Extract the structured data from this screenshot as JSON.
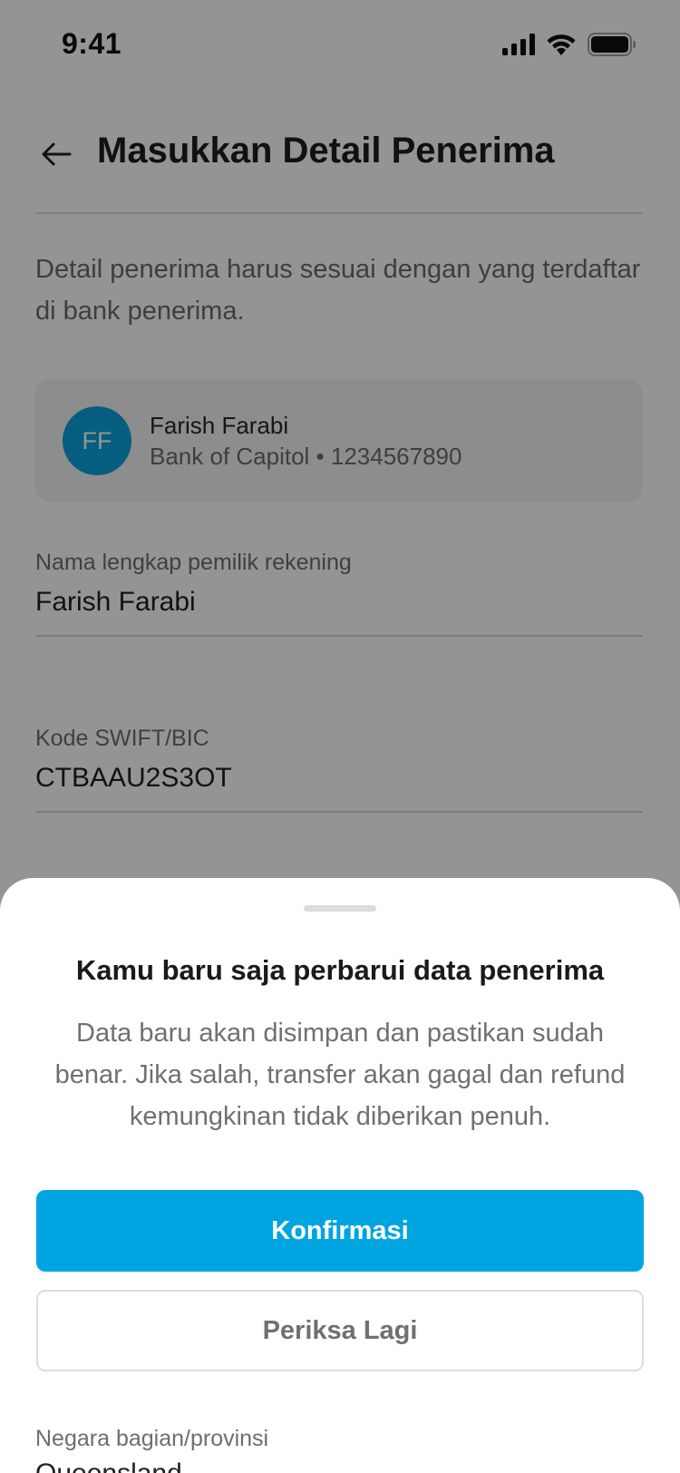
{
  "status_bar": {
    "time": "9:41",
    "icons": [
      "signal-icon",
      "wifi-icon",
      "battery-icon"
    ]
  },
  "header": {
    "back_icon": "arrow-left-icon",
    "title": "Masukkan Detail Penerima"
  },
  "intro_text": "Detail penerima harus sesuai dengan yang terdaftar di bank penerima.",
  "recipient": {
    "initials": "FF",
    "name": "Farish Farabi",
    "meta": "Bank of Capitol • 1234567890",
    "avatar_color": "#0aa3dc"
  },
  "form": {
    "account_holder": {
      "label": "Nama lengkap pemilik rekening",
      "value": "Farish Farabi"
    },
    "swift": {
      "label": "Kode SWIFT/BIC",
      "value": "CTBAAU2S3OT"
    },
    "state": {
      "label": "Negara bagian/provinsi",
      "value": "Queensland"
    }
  },
  "sheet": {
    "title": "Kamu baru saja perbarui data penerima",
    "description": "Data baru akan disimpan dan pastikan sudah benar. Jika salah, transfer akan gagal dan refund kemungkinan tidak diberikan penuh.",
    "confirm_label": "Konfirmasi",
    "recheck_label": "Periksa Lagi"
  },
  "colors": {
    "accent": "#00a4e0",
    "overlay": "rgba(0,0,0,0.42)"
  }
}
